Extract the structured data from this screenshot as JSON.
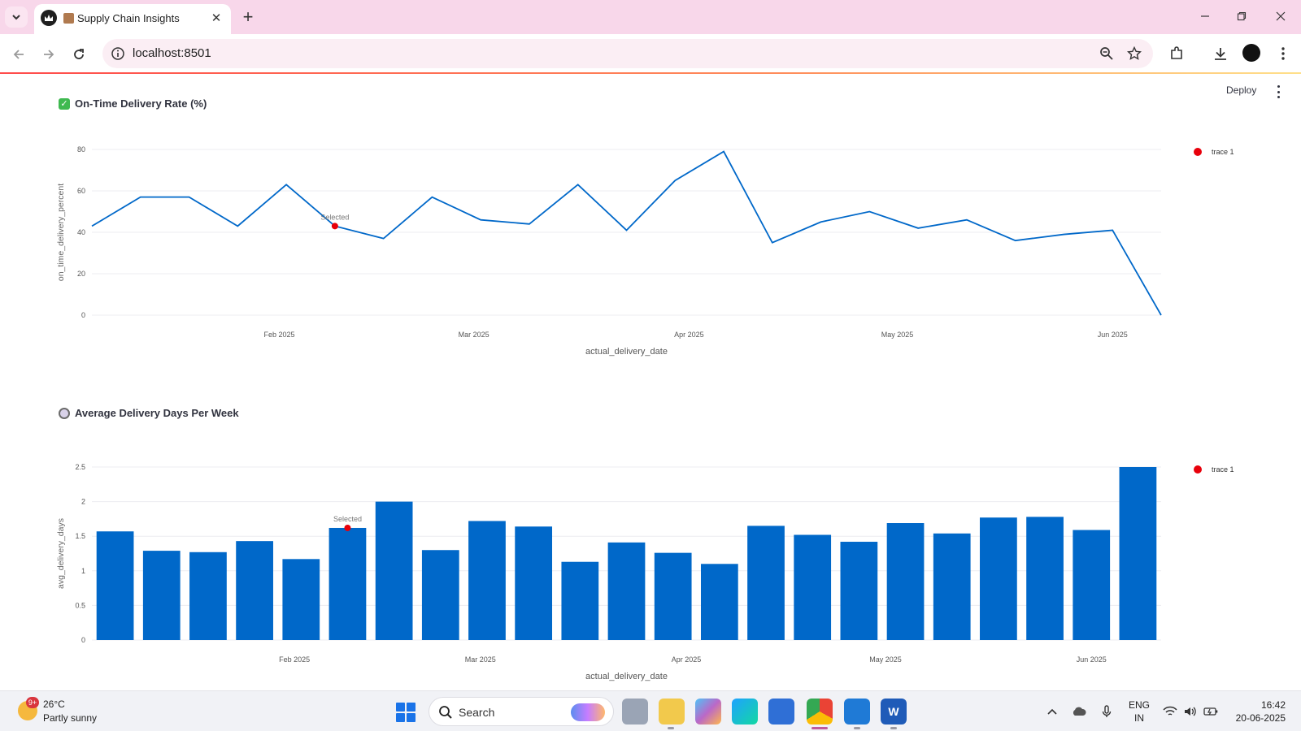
{
  "browser": {
    "tab_title": "Supply Chain Insights",
    "url": "localhost:8501"
  },
  "app": {
    "deploy_label": "Deploy"
  },
  "section1": {
    "icon": "check-icon",
    "title": "On-Time Delivery Rate (%)"
  },
  "section2": {
    "icon": "clock-icon",
    "title": "Average Delivery Days Per Week"
  },
  "charts": {
    "chart_data": [
      {
        "type": "line",
        "xlabel": "actual_delivery_date",
        "ylabel": "on_time_delivery_percent",
        "x_tick_labels": [
          "Feb 2025",
          "Mar 2025",
          "Apr 2025",
          "May 2025",
          "Jun 2025"
        ],
        "y_ticks": [
          "0",
          "20",
          "40",
          "60",
          "80"
        ],
        "ylim": [
          0,
          80
        ],
        "x": [
          "2025-01-05",
          "2025-01-12",
          "2025-01-19",
          "2025-01-26",
          "2025-02-02",
          "2025-02-09",
          "2025-02-16",
          "2025-02-23",
          "2025-03-02",
          "2025-03-09",
          "2025-03-16",
          "2025-03-23",
          "2025-03-30",
          "2025-04-06",
          "2025-04-13",
          "2025-04-20",
          "2025-04-27",
          "2025-05-04",
          "2025-05-11",
          "2025-05-18",
          "2025-05-25",
          "2025-06-01",
          "2025-06-08"
        ],
        "series": [
          {
            "name": "trace 1",
            "values": [
              43,
              57,
              57,
              43,
              63,
              43,
              37,
              57,
              46,
              44,
              63,
              41,
              65,
              79,
              35,
              45,
              50,
              42,
              46,
              36,
              39,
              41,
              0
            ],
            "color": "#0068c9"
          }
        ],
        "selected_marker": {
          "label": "Selected",
          "x": "2025-02-09",
          "y": 43,
          "color": "#e8000b"
        },
        "legend": {
          "position": "top-right",
          "entries": [
            {
              "label": "trace 1",
              "color": "#e8000b"
            }
          ]
        },
        "grid": true
      },
      {
        "type": "bar",
        "xlabel": "actual_delivery_date",
        "ylabel": "avg_delivery_days",
        "x_tick_labels": [
          "Feb 2025",
          "Mar 2025",
          "Apr 2025",
          "May 2025",
          "Jun 2025"
        ],
        "y_ticks": [
          "0",
          "0.5",
          "1",
          "1.5",
          "2",
          "2.5"
        ],
        "ylim": [
          0,
          2.5
        ],
        "x": [
          "2025-01-05",
          "2025-01-12",
          "2025-01-19",
          "2025-01-26",
          "2025-02-02",
          "2025-02-09",
          "2025-02-16",
          "2025-02-23",
          "2025-03-02",
          "2025-03-09",
          "2025-03-16",
          "2025-03-23",
          "2025-03-30",
          "2025-04-06",
          "2025-04-13",
          "2025-04-20",
          "2025-04-27",
          "2025-05-04",
          "2025-05-11",
          "2025-05-18",
          "2025-05-25",
          "2025-06-01",
          "2025-06-08"
        ],
        "series": [
          {
            "name": "trace 1",
            "values": [
              1.57,
              1.29,
              1.27,
              1.43,
              1.17,
              1.62,
              2.0,
              1.3,
              1.72,
              1.64,
              1.13,
              1.41,
              1.26,
              1.1,
              1.65,
              1.52,
              1.42,
              1.69,
              1.54,
              1.77,
              1.78,
              1.59,
              2.5
            ],
            "color": "#0068c9"
          }
        ],
        "selected_marker": {
          "label": "Selected",
          "x": "2025-02-09",
          "y": 1.62,
          "color": "#e8000b"
        },
        "legend": {
          "position": "top-right",
          "entries": [
            {
              "label": "trace 1",
              "color": "#e8000b"
            }
          ]
        },
        "grid": true
      }
    ]
  },
  "taskbar": {
    "weather_badge": "9+",
    "weather_temp": "26°C",
    "weather_condition": "Partly sunny",
    "search_label": "Search",
    "lang_line1": "ENG",
    "lang_line2": "IN",
    "time": "16:42",
    "date": "20-06-2025"
  }
}
